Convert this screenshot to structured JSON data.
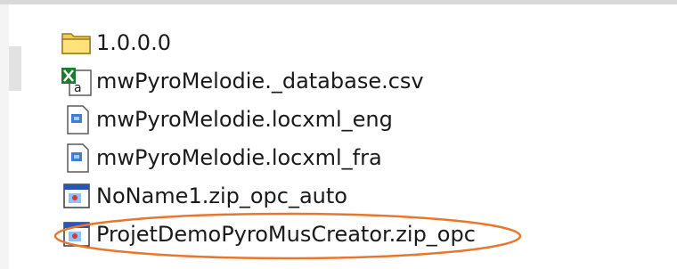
{
  "colors": {
    "annotation": "#e8772e",
    "folder": "#f2cc55",
    "excel": "#1e7a2e",
    "text": "#1a1a1a"
  },
  "files": [
    {
      "name": "1.0.0.0",
      "icon": "folder-icon"
    },
    {
      "name": "mwPyroMelodie._database.csv",
      "icon": "excel-csv-icon"
    },
    {
      "name": "mwPyroMelodie.locxml_eng",
      "icon": "xml-document-icon"
    },
    {
      "name": "mwPyroMelodie.locxml_fra",
      "icon": "xml-document-icon"
    },
    {
      "name": "NoName1.zip_opc_auto",
      "icon": "application-window-icon"
    },
    {
      "name": "ProjetDemoPyroMusCreator.zip_opc",
      "icon": "application-window-icon",
      "highlighted": true
    }
  ]
}
